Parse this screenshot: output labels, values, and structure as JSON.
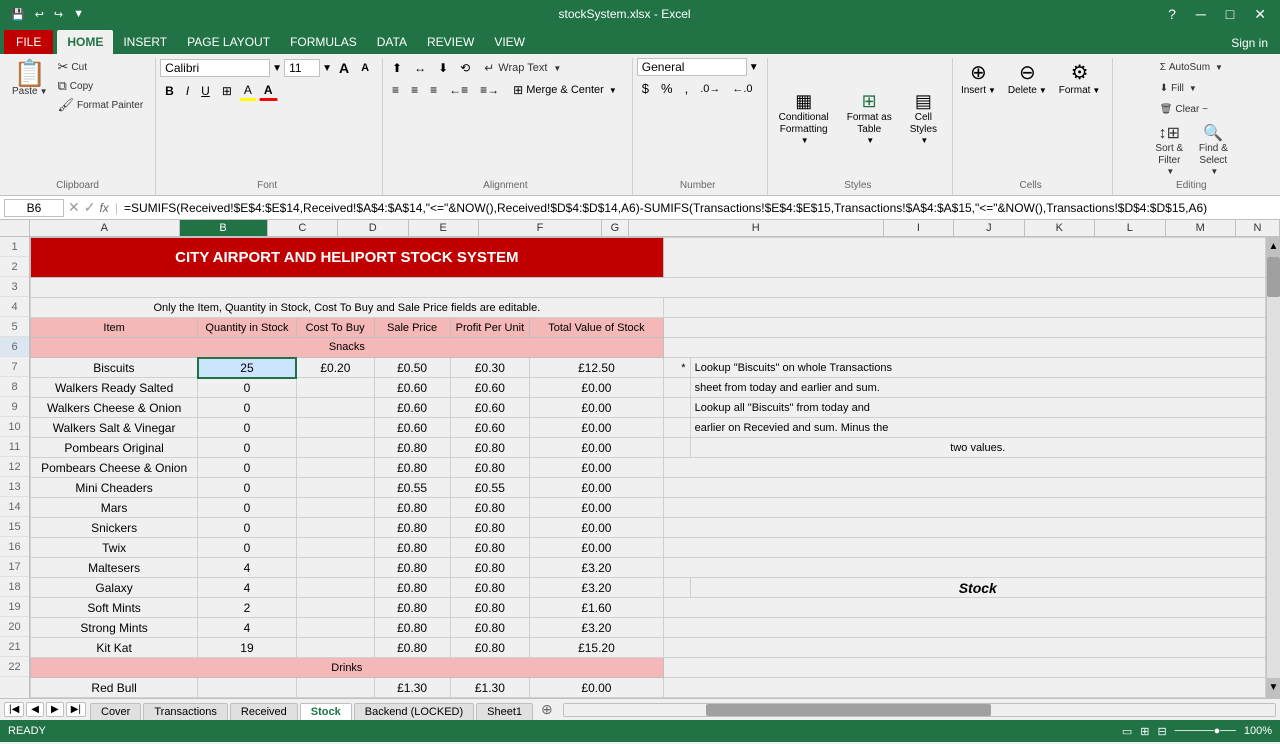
{
  "window": {
    "title": "stockSystem.xlsx - Excel",
    "minimize": "─",
    "restore": "□",
    "close": "✕"
  },
  "quickAccess": {
    "save": "💾",
    "undo": "↩",
    "redo": "↪",
    "customize": "▼"
  },
  "ribbonTabs": [
    {
      "id": "file",
      "label": "FILE",
      "active": false
    },
    {
      "id": "home",
      "label": "HOME",
      "active": true
    },
    {
      "id": "insert",
      "label": "INSERT",
      "active": false
    },
    {
      "id": "page-layout",
      "label": "PAGE LAYOUT",
      "active": false
    },
    {
      "id": "formulas",
      "label": "FORMULAS",
      "active": false
    },
    {
      "id": "data",
      "label": "DATA",
      "active": false
    },
    {
      "id": "review",
      "label": "REVIEW",
      "active": false
    },
    {
      "id": "view",
      "label": "VIEW",
      "active": false
    }
  ],
  "ribbon": {
    "paste_label": "Paste",
    "cut_label": "Cut",
    "copy_label": "Copy",
    "format_painter_label": "Format Painter",
    "clipboard_label": "Clipboard",
    "font_name": "Calibri",
    "font_size": "11",
    "font_label": "Font",
    "bold": "B",
    "italic": "I",
    "underline": "U",
    "increase_font": "A",
    "decrease_font": "A",
    "borders_label": "Borders",
    "fill_color_label": "Fill Color",
    "font_color_label": "Font Color",
    "alignment_label": "Alignment",
    "align_left": "≡",
    "align_center": "≡",
    "align_right": "≡",
    "indent_dec": "←",
    "indent_inc": "→",
    "orientation": "⟳",
    "wrap_text": "Wrap Text",
    "merge_center": "Merge & Center",
    "number_label": "Number",
    "number_format": "General",
    "currency": "$",
    "percent": "%",
    "comma": ",",
    "inc_decimal": ".0",
    "dec_decimal": "0.",
    "styles_label": "Styles",
    "conditional_formatting": "Conditional\nFormatting",
    "format_as_table": "Format as\nTable",
    "cell_styles": "Cell\nStyles",
    "cells_label": "Cells",
    "insert_cells": "Insert",
    "delete_cells": "Delete",
    "format_cells": "Format",
    "editing_label": "Editing",
    "autosum": "AutoSum",
    "fill": "Fill",
    "clear": "Clear ~",
    "sort_filter": "Sort &\nFilter",
    "find_select": "Find &\nSelect",
    "sign_in": "Sign in"
  },
  "formulaBar": {
    "cell_ref": "B6",
    "fx": "fx",
    "formula": "=SUMIFS(Received!$E$4:$E$14,Received!$A$4:$A$14,\"<=\"&NOW(),Received!$D$4:$D$14,A6)-SUMIFS(Transactions!$E$4:$E$15,Transactions!$A$4:$A$15,\"<=\"&NOW(),Transactions!$D$4:$D$15,A6)"
  },
  "columns": {
    "headers": [
      "",
      "A",
      "B",
      "C",
      "D",
      "E",
      "F",
      "G",
      "H",
      "I",
      "J",
      "K",
      "L",
      "M",
      "N"
    ],
    "selected": "B"
  },
  "spreadsheet": {
    "title": "CITY AIRPORT AND HELIPORT STOCK SYSTEM",
    "subtitle": "Only the Item, Quantity in Stock, Cost To Buy and Sale Price fields are editable.",
    "col_headers": [
      "Item",
      "Quantity in Stock",
      "Cost To Buy",
      "Sale Price",
      "Profit Per Unit",
      "Total Value of Stock"
    ],
    "section_snacks": "Snacks",
    "section_drinks": "Drinks",
    "rows": [
      {
        "row": 6,
        "item": "Biscuits",
        "qty": "25",
        "cost": "£0.20",
        "sale": "£0.50",
        "profit": "£0.30",
        "total": "£12.50"
      },
      {
        "row": 7,
        "item": "Walkers Ready Salted",
        "qty": "0",
        "cost": "",
        "sale": "£0.60",
        "profit": "£0.60",
        "total": "£0.00"
      },
      {
        "row": 8,
        "item": "Walkers Cheese & Onion",
        "qty": "0",
        "cost": "",
        "sale": "£0.60",
        "profit": "£0.60",
        "total": "£0.00"
      },
      {
        "row": 9,
        "item": "Walkers Salt & Vinegar",
        "qty": "0",
        "cost": "",
        "sale": "£0.60",
        "profit": "£0.60",
        "total": "£0.00"
      },
      {
        "row": 10,
        "item": "Pombears Original",
        "qty": "0",
        "cost": "",
        "sale": "£0.80",
        "profit": "£0.80",
        "total": "£0.00"
      },
      {
        "row": 11,
        "item": "Pombears Cheese & Onion",
        "qty": "0",
        "cost": "",
        "sale": "£0.80",
        "profit": "£0.80",
        "total": "£0.00"
      },
      {
        "row": 12,
        "item": "Mini Cheaders",
        "qty": "0",
        "cost": "",
        "sale": "£0.55",
        "profit": "£0.55",
        "total": "£0.00"
      },
      {
        "row": 13,
        "item": "Mars",
        "qty": "0",
        "cost": "",
        "sale": "£0.80",
        "profit": "£0.80",
        "total": "£0.00"
      },
      {
        "row": 14,
        "item": "Snickers",
        "qty": "0",
        "cost": "",
        "sale": "£0.80",
        "profit": "£0.80",
        "total": "£0.00"
      },
      {
        "row": 15,
        "item": "Twix",
        "qty": "0",
        "cost": "",
        "sale": "£0.80",
        "profit": "£0.80",
        "total": "£0.00"
      },
      {
        "row": 16,
        "item": "Maltesers",
        "qty": "4",
        "cost": "",
        "sale": "£0.80",
        "profit": "£0.80",
        "total": "£3.20"
      },
      {
        "row": 17,
        "item": "Galaxy",
        "qty": "4",
        "cost": "",
        "sale": "£0.80",
        "profit": "£0.80",
        "total": "£3.20"
      },
      {
        "row": 18,
        "item": "Soft Mints",
        "qty": "2",
        "cost": "",
        "sale": "£0.80",
        "profit": "£0.80",
        "total": "£1.60"
      },
      {
        "row": 19,
        "item": "Strong Mints",
        "qty": "4",
        "cost": "",
        "sale": "£0.80",
        "profit": "£0.80",
        "total": "£3.20"
      },
      {
        "row": 20,
        "item": "Kit Kat",
        "qty": "19",
        "cost": "",
        "sale": "£0.80",
        "profit": "£0.80",
        "total": "£15.20"
      },
      {
        "row": 22,
        "item": "Red Bull",
        "qty": "",
        "cost": "",
        "sale": "£1.30",
        "profit": "£1.30",
        "total": "£0.00"
      }
    ],
    "note_star": "*",
    "note_text1": "Lookup \"Biscuits\" on whole Transactions",
    "note_text2": "sheet from today and earlier and sum.",
    "note_text3": "Lookup all \"Biscuits\" from today and",
    "note_text4": "earlier on Recevied and sum. Minus the",
    "note_text5": "two values.",
    "stock_label": "Stock"
  },
  "sheetTabs": [
    {
      "label": "Cover",
      "active": false
    },
    {
      "label": "Transactions",
      "active": false
    },
    {
      "label": "Received",
      "active": false
    },
    {
      "label": "Stock",
      "active": true
    },
    {
      "label": "Backend (LOCKED)",
      "active": false
    },
    {
      "label": "Sheet1",
      "active": false
    }
  ],
  "statusBar": {
    "status": "READY",
    "zoom": "100%"
  }
}
